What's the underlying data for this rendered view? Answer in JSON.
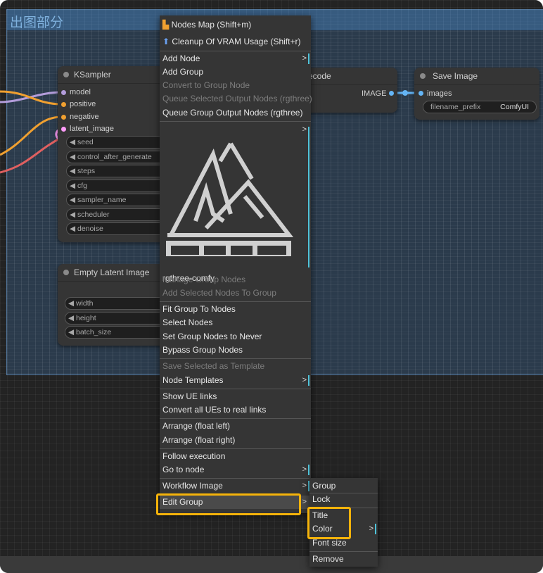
{
  "group": {
    "title": "出图部分"
  },
  "ksampler": {
    "title": "KSampler",
    "inputs": [
      "model",
      "positive",
      "negative",
      "latent_image"
    ],
    "widgets": [
      "seed",
      "control_after_generate",
      "steps",
      "cfg",
      "sampler_name",
      "scheduler",
      "denoise"
    ]
  },
  "empty_latent": {
    "title": "Empty Latent Image",
    "widgets": [
      "width",
      "height",
      "batch_size"
    ]
  },
  "vae_decode": {
    "title_fragment": "ecode",
    "output": "IMAGE"
  },
  "save_image": {
    "title": "Save Image",
    "input": "images",
    "filename_label": "filename_prefix",
    "filename_value": "ComfyUI"
  },
  "context_menu": {
    "nodes_map": "Nodes Map (Shift+m)",
    "cleanup_vram": "Cleanup Of VRAM Usage (Shift+r)",
    "add_node": "Add Node",
    "add_group": "Add Group",
    "convert_group_node": "Convert to Group Node",
    "queue_selected": "Queue Selected Output Nodes (rgthree)",
    "queue_group": "Queue Group Output Nodes (rgthree)",
    "rgthree_label": "rgthree-comfy",
    "manage_group_nodes": "Manage Group Nodes",
    "add_selected_to_group": "Add Selected Nodes To Group",
    "fit_group": "Fit Group To Nodes",
    "select_nodes": "Select Nodes",
    "set_never": "Set Group Nodes to Never",
    "bypass_group": "Bypass Group Nodes",
    "save_template": "Save Selected as Template",
    "node_templates": "Node Templates",
    "show_ue_links": "Show UE links",
    "convert_ues": "Convert all UEs to real links",
    "arrange_left": "Arrange (float left)",
    "arrange_right": "Arrange (float right)",
    "follow_execution": "Follow execution",
    "go_to_node": "Go to node",
    "workflow_image": "Workflow Image",
    "edit_group": "Edit Group",
    "arrow": ">"
  },
  "submenu": {
    "header": "Group",
    "items": [
      "Lock",
      "Title",
      "Color",
      "Font size",
      "Remove"
    ]
  },
  "colors": {
    "highlight": "#f5b30a",
    "accent_bar": "#4fc3d9",
    "group_title": "#7fb1de",
    "link_model": "#b39ddb",
    "link_positive": "#f0a030",
    "link_latent": "#ff9cf9",
    "link_vae": "#e06060",
    "link_image": "#64b5f6"
  }
}
